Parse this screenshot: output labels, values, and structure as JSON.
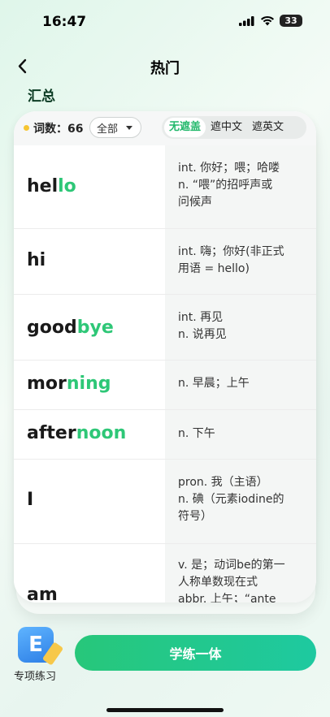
{
  "status": {
    "time": "16:47",
    "battery": "33"
  },
  "header": {
    "title": "热门",
    "back_icon": "chevron-left-icon"
  },
  "section_label": "汇总",
  "toolbar": {
    "count_label": "词数：66",
    "filter_value": "全部",
    "segments": [
      "无遮盖",
      "遮中文",
      "遮英文"
    ],
    "active_segment": 0
  },
  "words": [
    {
      "prefix": "hel",
      "highlight": "lo",
      "suffix": "",
      "meaning": "int. 你好；喂；哈喽\nn. “喂”的招呼声或\n问候声"
    },
    {
      "prefix": "hi",
      "highlight": "",
      "suffix": "",
      "meaning": "int. 嗨；你好(非正式\n用语 = hello)"
    },
    {
      "prefix": "good",
      "highlight": "bye",
      "suffix": "",
      "meaning": "int. 再见\n n. 说再见"
    },
    {
      "prefix": "mor",
      "highlight": "ning",
      "suffix": "",
      "meaning": "n. 早晨；上午"
    },
    {
      "prefix": "after",
      "highlight": "noon",
      "suffix": "",
      "meaning": "n. 下午"
    },
    {
      "prefix": "I",
      "highlight": "",
      "suffix": "",
      "meaning": "pron. 我（主语）\nn. 碘（元素iodine的\n符号）"
    },
    {
      "prefix": "am",
      "highlight": "",
      "suffix": "",
      "meaning": "v. 是；动词be的第一\n人称单数现在式\n abbr. 上午；“ante"
    }
  ],
  "bottom": {
    "practice_label": "专项练习",
    "practice_icon_letter": "E",
    "primary_button": "学练一体"
  },
  "colors": {
    "accent": "#2ec777",
    "button": "#22c77f",
    "dot": "#f6c531"
  }
}
